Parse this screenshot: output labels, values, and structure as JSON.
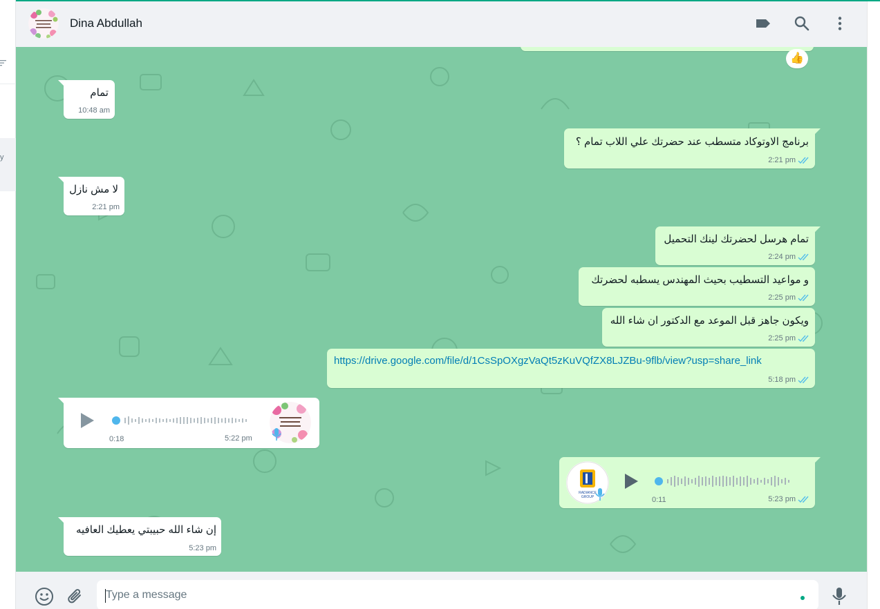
{
  "header": {
    "contact_name": "Dina Abdullah",
    "avatar_text_line1": "سبحان الله وبحمده",
    "avatar_text_line2": "سبحان الله العظيم"
  },
  "messages": [
    {
      "dir": "in",
      "text": "تمام",
      "time": "10:48 am"
    },
    {
      "dir": "out",
      "text": "برنامج الاوتوكاد متسطب عند حضرتك علي اللاب تمام ؟",
      "time": "2:21 pm",
      "status": "read"
    },
    {
      "dir": "in",
      "text": "لا مش نازل",
      "time": "2:21 pm"
    },
    {
      "dir": "out",
      "text": "تمام هرسل لحضرتك لينك التحميل",
      "time": "2:24 pm",
      "status": "read"
    },
    {
      "dir": "out",
      "text": "و مواعيد التسطيب بحيث المهندس يسطبه لحضرتك",
      "time": "2:25 pm",
      "status": "read"
    },
    {
      "dir": "out",
      "text": "ويكون جاهز قبل الموعد مع الدكتور ان شاء الله",
      "time": "2:25 pm",
      "status": "read"
    },
    {
      "dir": "out",
      "link": "https://drive.google.com/file/d/1CsSpOXgzVaQt5zKuVQfZX8LJZBu-9flb/view?usp=share_link",
      "time": "5:18 pm",
      "status": "read"
    },
    {
      "dir": "in",
      "voice": true,
      "duration": "0:18",
      "time": "5:22 pm"
    },
    {
      "dir": "out",
      "voice": true,
      "duration": "0:11",
      "time": "5:23 pm",
      "status": "read",
      "avatar_text": "RADIANCE GROUP"
    },
    {
      "dir": "in",
      "text": "إن شاء الله حبيبتي يعطيك العافيه",
      "time": "5:23 pm"
    }
  ],
  "reaction": "👍",
  "composer": {
    "placeholder": "Type a message"
  },
  "colors": {
    "chat_bg": "#7fcaa3",
    "outgoing_bubble": "#d9fdd3",
    "incoming_bubble": "#ffffff",
    "read_ticks": "#53bdeb",
    "link": "#027eb5",
    "accent": "#00a884"
  },
  "icons": [
    "label-icon",
    "search-icon",
    "menu-icon",
    "emoji-icon",
    "attach-icon",
    "mic-icon",
    "play-icon"
  ]
}
